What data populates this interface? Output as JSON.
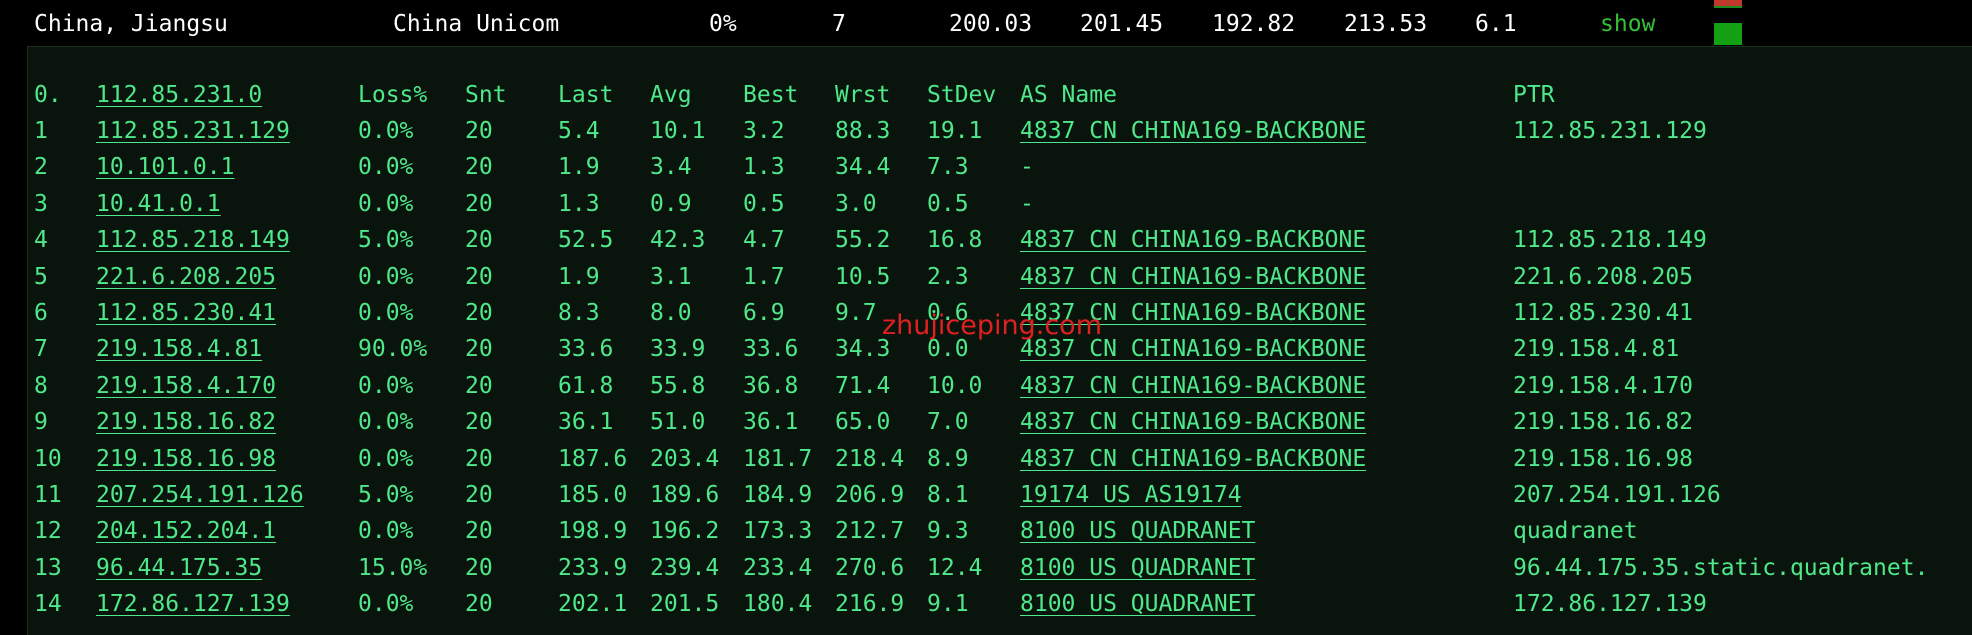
{
  "summary": {
    "location": "China, Jiangsu",
    "isp": "China Unicom",
    "loss": "0%",
    "hops": "7",
    "last": "200.03",
    "avg": "201.45",
    "best": "192.82",
    "worst": "213.53",
    "stdev": "6.1",
    "show_label": "show",
    "status_color": "#13a013"
  },
  "header": {
    "hop": "0.",
    "host": "112.85.231.0",
    "loss": "Loss%",
    "snt": "Snt",
    "last": "Last",
    "avg": "Avg",
    "best": "Best",
    "wrst": "Wrst",
    "stdev": "StDev",
    "as_name": "AS Name",
    "ptr": "PTR"
  },
  "rows": [
    {
      "hop": "1",
      "host": "112.85.231.129",
      "loss": "0.0%",
      "snt": "20",
      "last": "5.4",
      "avg": "10.1",
      "best": "3.2",
      "wrst": "88.3",
      "stdev": "19.1",
      "as": "4837  CN CHINA169-BACKBONE",
      "ptr": "112.85.231.129"
    },
    {
      "hop": "2",
      "host": "10.101.0.1",
      "loss": "0.0%",
      "snt": "20",
      "last": "1.9",
      "avg": "3.4",
      "best": "1.3",
      "wrst": "34.4",
      "stdev": "7.3",
      "as": "-",
      "ptr": ""
    },
    {
      "hop": "3",
      "host": "10.41.0.1",
      "loss": "0.0%",
      "snt": "20",
      "last": "1.3",
      "avg": "0.9",
      "best": "0.5",
      "wrst": "3.0",
      "stdev": "0.5",
      "as": "-",
      "ptr": ""
    },
    {
      "hop": "4",
      "host": "112.85.218.149",
      "loss": "5.0%",
      "snt": "20",
      "last": "52.5",
      "avg": "42.3",
      "best": "4.7",
      "wrst": "55.2",
      "stdev": "16.8",
      "as": "4837  CN CHINA169-BACKBONE",
      "ptr": "112.85.218.149"
    },
    {
      "hop": "5",
      "host": "221.6.208.205",
      "loss": "0.0%",
      "snt": "20",
      "last": "1.9",
      "avg": "3.1",
      "best": "1.7",
      "wrst": "10.5",
      "stdev": "2.3",
      "as": "4837  CN CHINA169-BACKBONE",
      "ptr": "221.6.208.205"
    },
    {
      "hop": "6",
      "host": "112.85.230.41",
      "loss": "0.0%",
      "snt": "20",
      "last": "8.3",
      "avg": "8.0",
      "best": "6.9",
      "wrst": "9.7",
      "stdev": "0.6",
      "as": "4837  CN CHINA169-BACKBONE",
      "ptr": "112.85.230.41"
    },
    {
      "hop": "7",
      "host": "219.158.4.81",
      "loss": "90.0%",
      "snt": "20",
      "last": "33.6",
      "avg": "33.9",
      "best": "33.6",
      "wrst": "34.3",
      "stdev": "0.0",
      "as": "4837  CN CHINA169-BACKBONE",
      "ptr": "219.158.4.81"
    },
    {
      "hop": "8",
      "host": "219.158.4.170",
      "loss": "0.0%",
      "snt": "20",
      "last": "61.8",
      "avg": "55.8",
      "best": "36.8",
      "wrst": "71.4",
      "stdev": "10.0",
      "as": "4837  CN CHINA169-BACKBONE",
      "ptr": "219.158.4.170"
    },
    {
      "hop": "9",
      "host": "219.158.16.82",
      "loss": "0.0%",
      "snt": "20",
      "last": "36.1",
      "avg": "51.0",
      "best": "36.1",
      "wrst": "65.0",
      "stdev": "7.0",
      "as": "4837  CN CHINA169-BACKBONE",
      "ptr": "219.158.16.82"
    },
    {
      "hop": "10",
      "host": "219.158.16.98",
      "loss": "0.0%",
      "snt": "20",
      "last": "187.6",
      "avg": "203.4",
      "best": "181.7",
      "wrst": "218.4",
      "stdev": "8.9",
      "as": "4837  CN CHINA169-BACKBONE",
      "ptr": "219.158.16.98"
    },
    {
      "hop": "11",
      "host": "207.254.191.126",
      "loss": "5.0%",
      "snt": "20",
      "last": "185.0",
      "avg": "189.6",
      "best": "184.9",
      "wrst": "206.9",
      "stdev": "8.1",
      "as": "19174 US AS19174",
      "ptr": "207.254.191.126"
    },
    {
      "hop": "12",
      "host": "204.152.204.1",
      "loss": "0.0%",
      "snt": "20",
      "last": "198.9",
      "avg": "196.2",
      "best": "173.3",
      "wrst": "212.7",
      "stdev": "9.3",
      "as": "8100  US QUADRANET",
      "ptr": "quadranet"
    },
    {
      "hop": "13",
      "host": "96.44.175.35",
      "loss": "15.0%",
      "snt": "20",
      "last": "233.9",
      "avg": "239.4",
      "best": "233.4",
      "wrst": "270.6",
      "stdev": "12.4",
      "as": "8100  US QUADRANET",
      "ptr": "96.44.175.35.static.quadranet."
    },
    {
      "hop": "14",
      "host": "172.86.127.139",
      "loss": "0.0%",
      "snt": "20",
      "last": "202.1",
      "avg": "201.5",
      "best": "180.4",
      "wrst": "216.9",
      "stdev": "9.1",
      "as": "8100  US QUADRANET",
      "ptr": "172.86.127.139"
    }
  ],
  "watermark": "zhujiceping.com"
}
